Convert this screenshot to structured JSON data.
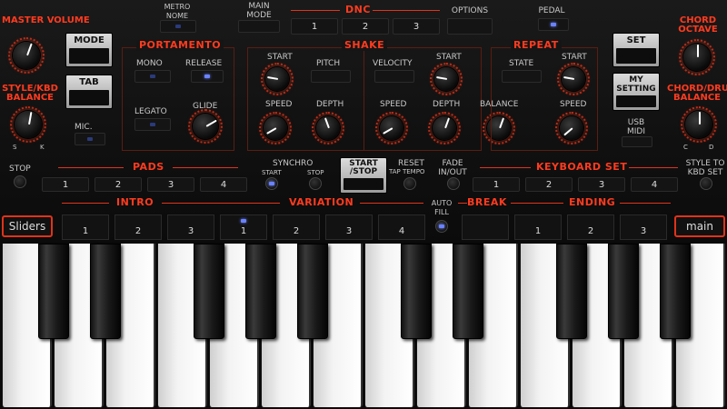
{
  "left_column": {
    "master_volume": "MASTER VOLUME",
    "style_kbd_balance": "STYLE/KBD BALANCE",
    "balance_s": "S",
    "balance_k": "K",
    "mode_button": "MODE",
    "tab_button": "TAB",
    "mic": "MIC."
  },
  "top_row": {
    "metronome": "METRO NOME",
    "main_mode": "MAIN MODE",
    "dnc": "DNC",
    "dnc_buttons": [
      "1",
      "2",
      "3"
    ],
    "options": "OPTIONS",
    "pedal": "PEDAL"
  },
  "portamento": {
    "title": "PORTAMENTO",
    "mono": "MONO",
    "release": "RELEASE",
    "legato": "LEGATO",
    "glide": "GLIDE"
  },
  "shake": {
    "title": "SHAKE",
    "start": "START",
    "pitch": "PITCH",
    "speed": "SPEED",
    "depth": "DEPTH",
    "velocity": "VELOCITY",
    "start2": "START",
    "speed2": "SPEED",
    "depth2": "DEPTH",
    "balance": "BALANCE"
  },
  "repeat": {
    "title": "REPEAT",
    "state": "STATE",
    "start": "START",
    "speed": "SPEED"
  },
  "right_column": {
    "chord_octave": "CHORD OCTAVE",
    "chord_drum_balance": "CHORD/DRUM BALANCE",
    "balance_c": "C",
    "balance_d": "D",
    "set_button": "SET",
    "my_setting_button": "MY SETTING",
    "usb_midi": "USB MIDI"
  },
  "middle_row": {
    "stop": "STOP",
    "pads_title": "PADS",
    "pads": [
      "1",
      "2",
      "3",
      "4"
    ],
    "synchro": "SYNCHRO",
    "synchro_start": "START",
    "synchro_stop": "STOP",
    "start_stop": "START /STOP",
    "reset": "RESET",
    "tap_tempo": "TAP TEMPO",
    "fade": "FADE IN/OUT",
    "keyboard_set_title": "KEYBOARD SET",
    "keyboard_set": [
      "1",
      "2",
      "3",
      "4"
    ],
    "style_to_kbd": "STYLE TO KBD SET"
  },
  "bottom_row": {
    "intro_title": "INTRO",
    "intro": [
      "1",
      "2",
      "3"
    ],
    "variation_title": "VARIATION",
    "variation": [
      "1",
      "2",
      "3",
      "4"
    ],
    "auto_fill": "AUTO FILL",
    "break_title": "BREAK",
    "ending_title": "ENDING",
    "ending": [
      "1",
      "2",
      "3"
    ],
    "sliders_button": "Sliders",
    "main_button": "main"
  }
}
